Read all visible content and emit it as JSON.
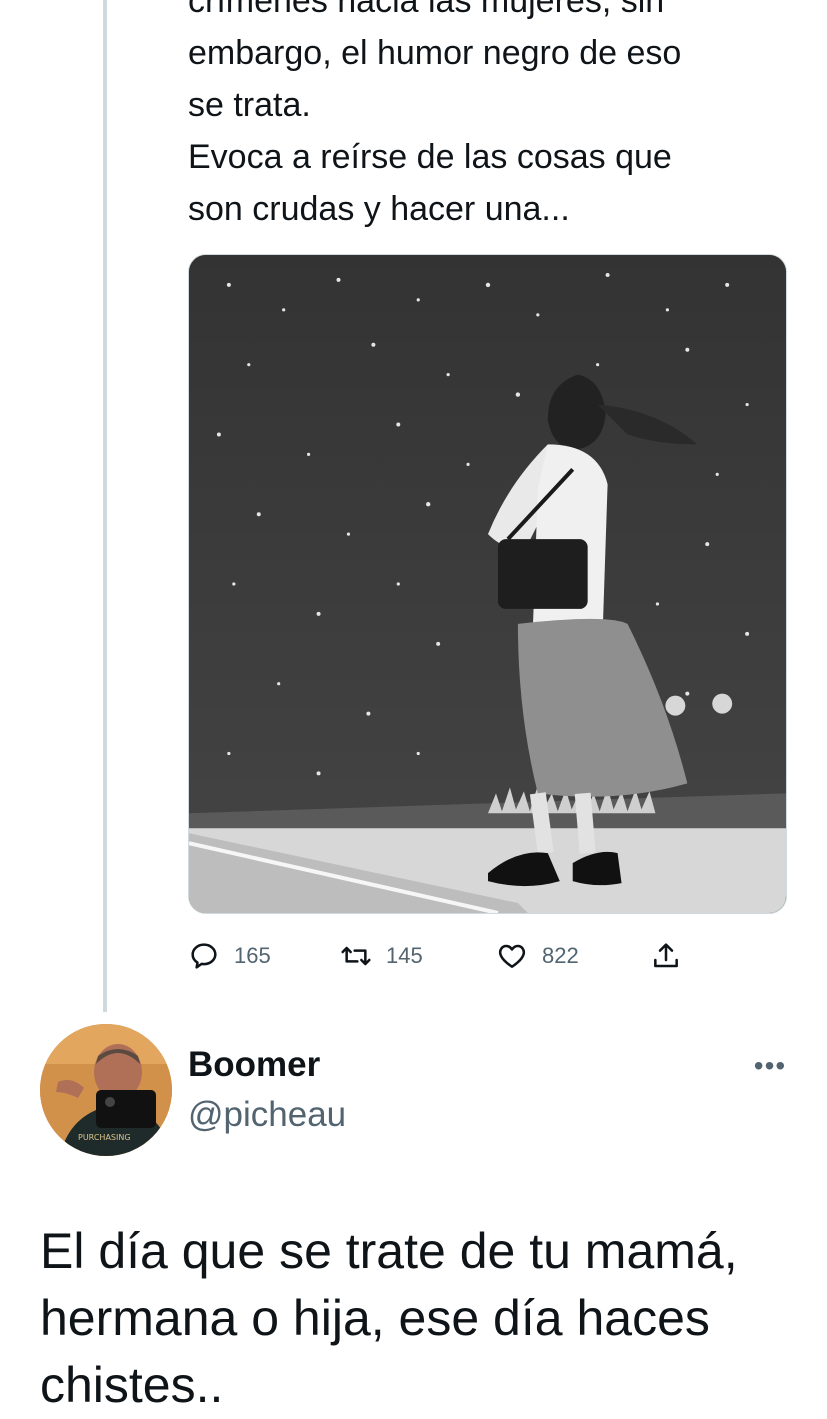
{
  "parent_tweet": {
    "text_lines": [
      "crímenes hacia las mujeres, sin",
      "embargo, el humor negro de eso",
      "se trata.",
      "Evoca a reírse de las cosas que",
      "son crudas y hacer una..."
    ],
    "image_alt": "Illustration of a woman with a shoulder bag standing under a starry night sky",
    "stats": {
      "replies": "165",
      "retweets": "145",
      "likes": "822"
    }
  },
  "reply_tweet": {
    "display_name": "Boomer",
    "handle": "@picheau",
    "more_label": "•••",
    "text_lines": [
      "El día que se trate de tu mamá,",
      "hermana o hija, ese día haces",
      "chistes.."
    ]
  },
  "colors": {
    "text_primary": "#0f1419",
    "text_secondary": "#536471",
    "thread_line": "#cfd9de"
  },
  "icons": [
    "reply-icon",
    "retweet-icon",
    "like-icon",
    "share-icon",
    "more-icon"
  ]
}
